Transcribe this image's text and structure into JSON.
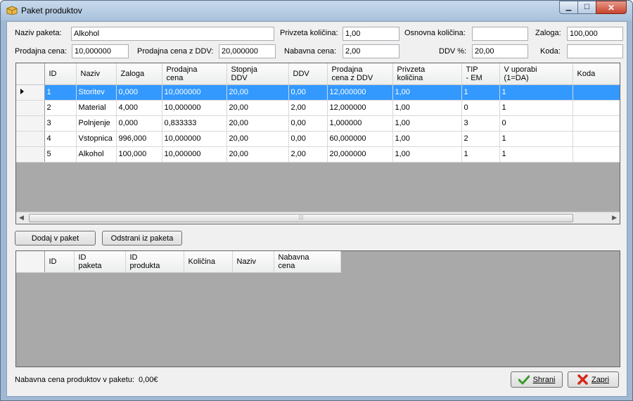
{
  "window": {
    "title": "Paket produktov"
  },
  "form": {
    "naziv_label": "Naziv paketa:",
    "naziv_value": "Alkohol",
    "privzeta_label": "Privzeta količina:",
    "privzeta_value": "1,00",
    "osnovna_label": "Osnovna količina:",
    "osnovna_value": "",
    "zaloga_label": "Zaloga:",
    "zaloga_value": "100,000",
    "prodajna_label": "Prodajna cena:",
    "prodajna_value": "10,000000",
    "prodajna_ddv_label": "Prodajna cena z DDV:",
    "prodajna_ddv_value": "20,000000",
    "nabavna_label": "Nabavna cena:",
    "nabavna_value": "2,00",
    "ddv_label": "DDV %:",
    "ddv_value": "20,00",
    "koda_label": "Koda:",
    "koda_value": ""
  },
  "products": {
    "headers": [
      "ID",
      "Naziv",
      "Zaloga",
      "Prodajna\ncena",
      "Stopnja\nDDV",
      "DDV",
      "Prodajna\ncena z DDV",
      "Privzeta\nkoličina",
      "TIP\n- EM",
      "V uporabi\n(1=DA)",
      "Koda"
    ],
    "rows": [
      [
        "1",
        "Storitev",
        "0,000",
        "10,000000",
        "20,00",
        "0,00",
        "12,000000",
        "1,00",
        "1",
        "1",
        ""
      ],
      [
        "2",
        "Material",
        "4,000",
        "10,000000",
        "20,00",
        "2,00",
        "12,000000",
        "1,00",
        "0",
        "1",
        ""
      ],
      [
        "3",
        "Polnjenje",
        "0,000",
        "0,833333",
        "20,00",
        "0,00",
        "1,000000",
        "1,00",
        "3",
        "0",
        ""
      ],
      [
        "4",
        "Vstopnica",
        "996,000",
        "10,000000",
        "20,00",
        "0,00",
        "60,000000",
        "1,00",
        "2",
        "1",
        ""
      ],
      [
        "5",
        "Alkohol",
        "100,000",
        "10,000000",
        "20,00",
        "2,00",
        "20,000000",
        "1,00",
        "1",
        "1",
        ""
      ]
    ],
    "selected_row": 0
  },
  "buttons": {
    "dodaj": "Dodaj v paket",
    "odstrani": "Odstrani iz paketa",
    "shrani": "Shrani",
    "zapri": "Zapri"
  },
  "package": {
    "headers": [
      "ID",
      "ID\npaketa",
      "ID\nprodukta",
      "Količina",
      "Naziv",
      "Nabavna\ncena"
    ]
  },
  "footer": {
    "label": "Nabavna cena produktov v paketu:",
    "value": "0,00€"
  },
  "icons": {
    "title": "package-icon",
    "save": "check-icon",
    "close": "red-x-icon"
  }
}
